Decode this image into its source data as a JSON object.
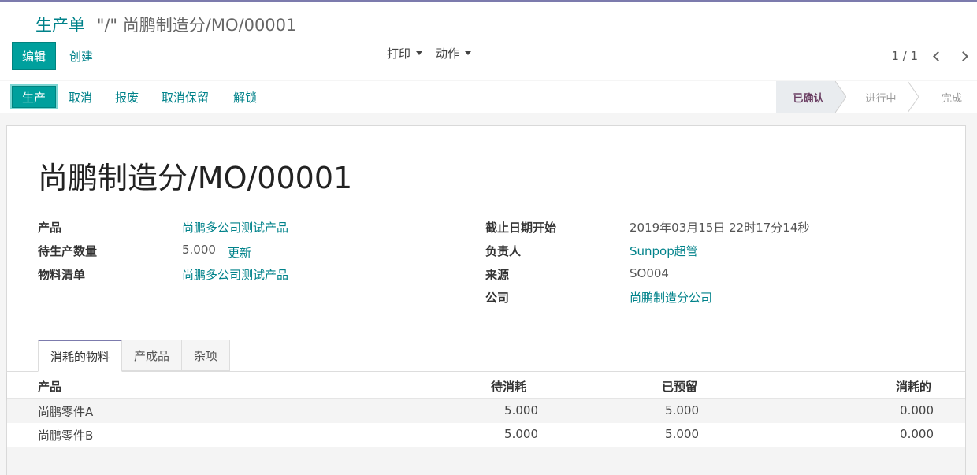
{
  "breadcrumb": {
    "parent": "生产单",
    "separator": "\"/\"",
    "current": "尚鹏制造分/MO/00001"
  },
  "toolbar": {
    "edit_label": "编辑",
    "create_label": "创建",
    "print_label": "打印",
    "action_label": "动作"
  },
  "pager": {
    "value": "1 / 1"
  },
  "statusbar": {
    "buttons": {
      "produce": "生产",
      "cancel": "取消",
      "scrap": "报废",
      "unreserve": "取消保留",
      "unlock": "解锁"
    },
    "stages": [
      {
        "label": "已确认",
        "active": true
      },
      {
        "label": "进行中",
        "active": false
      },
      {
        "label": "完成",
        "active": false
      }
    ]
  },
  "form": {
    "title": "尚鹏制造分/MO/00001",
    "left": {
      "product_label": "产品",
      "product_value": "尚鹏多公司测试产品",
      "qty_label": "待生产数量",
      "qty_value": "5.000",
      "qty_update": "更新",
      "bom_label": "物料清单",
      "bom_value": "尚鹏多公司测试产品"
    },
    "right": {
      "deadline_label": "截止日期开始",
      "deadline_value": "2019年03月15日 22时17分14秒",
      "responsible_label": "负责人",
      "responsible_value": "Sunpop超管",
      "source_label": "来源",
      "source_value": "SO004",
      "company_label": "公司",
      "company_value": "尚鹏制造分公司"
    }
  },
  "tabs": {
    "consumed": "消耗的物料",
    "finished": "产成品",
    "misc": "杂项"
  },
  "table": {
    "headers": {
      "product": "产品",
      "to_consume": "待消耗",
      "reserved": "已预留",
      "consumed": "消耗的"
    },
    "rows": [
      {
        "product": "尚鹏零件A",
        "to_consume": "5.000",
        "reserved": "5.000",
        "consumed": "0.000"
      },
      {
        "product": "尚鹏零件B",
        "to_consume": "5.000",
        "reserved": "5.000",
        "consumed": "0.000"
      }
    ]
  },
  "colors": {
    "primary": "#00a09d",
    "link": "#00828a",
    "brand_line": "#7c7bad",
    "active_stage": "#6b3f63"
  }
}
